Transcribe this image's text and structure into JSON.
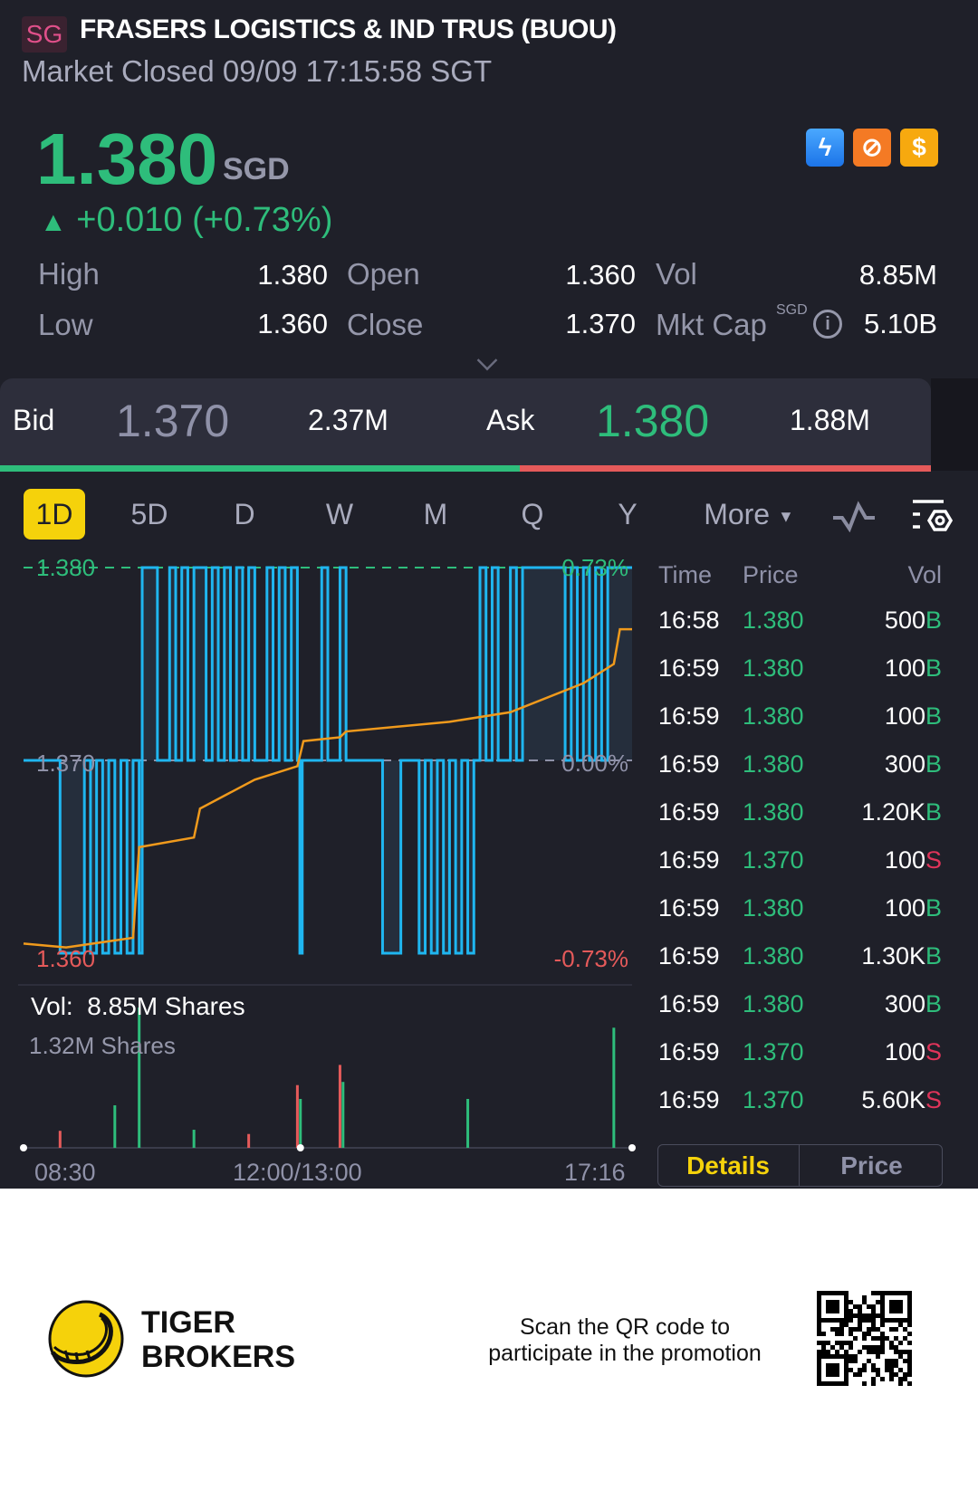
{
  "header": {
    "market_badge": "SG",
    "title": "FRASERS LOGISTICS & IND TRUS (BUOU)",
    "status": "Market Closed 09/09 17:15:58 SGT"
  },
  "quote": {
    "price": "1.380",
    "currency": "SGD",
    "change": "+0.010 (+0.73%)",
    "change_arrow": "▲",
    "stats": {
      "high_label": "High",
      "high": "1.380",
      "low_label": "Low",
      "low": "1.360",
      "open_label": "Open",
      "open": "1.360",
      "close_label": "Close",
      "close": "1.370",
      "vol_label": "Vol",
      "vol": "8.85M",
      "mktcap_label": "Mkt Cap",
      "mktcap_unit": "SGD",
      "mktcap": "5.10B"
    },
    "badges": [
      "lightning-level1-icon",
      "no-short-icon",
      "dollar-icon"
    ]
  },
  "bidask": {
    "bid_label": "Bid",
    "bid": "1.370",
    "bid_size": "2.37M",
    "ask_label": "Ask",
    "ask": "1.380",
    "ask_size": "1.88M",
    "bid_fraction": 0.558
  },
  "tabs": [
    "1D",
    "5D",
    "D",
    "W",
    "M",
    "Q",
    "Y",
    "More"
  ],
  "active_tab": "1D",
  "colors": {
    "up": "#2ebd7b",
    "down": "#e55a5a",
    "line": "#1fb6f0",
    "avg": "#f09a1c",
    "accent": "#f5d20b"
  },
  "chart_data": {
    "type": "line",
    "y_labels": {
      "top": "1.380",
      "mid": "1.370",
      "bottom": "1.360"
    },
    "pct_labels": {
      "top": "0.73%",
      "mid": "0.00%",
      "bottom": "-0.73%"
    },
    "ylim": [
      1.36,
      1.38
    ],
    "x_labels": [
      "08:30",
      "12:00/13:00",
      "17:16"
    ],
    "price_steps": [
      [
        0,
        1.37
      ],
      [
        6,
        1.36
      ],
      [
        10,
        1.37
      ],
      [
        11,
        1.36
      ],
      [
        12,
        1.37
      ],
      [
        13,
        1.36
      ],
      [
        14,
        1.37
      ],
      [
        15,
        1.36
      ],
      [
        16,
        1.37
      ],
      [
        17,
        1.36
      ],
      [
        18,
        1.37
      ],
      [
        19,
        1.36
      ],
      [
        19.5,
        1.38
      ],
      [
        22,
        1.37
      ],
      [
        24,
        1.38
      ],
      [
        25,
        1.37
      ],
      [
        26,
        1.38
      ],
      [
        27,
        1.37
      ],
      [
        28,
        1.38
      ],
      [
        30,
        1.37
      ],
      [
        31,
        1.38
      ],
      [
        32,
        1.37
      ],
      [
        33,
        1.38
      ],
      [
        34,
        1.37
      ],
      [
        35,
        1.38
      ],
      [
        36,
        1.37
      ],
      [
        37,
        1.38
      ],
      [
        38,
        1.37
      ],
      [
        40,
        1.38
      ],
      [
        41,
        1.37
      ],
      [
        42,
        1.38
      ],
      [
        43,
        1.37
      ],
      [
        44,
        1.38
      ],
      [
        45,
        1.37
      ],
      [
        45.4,
        1.36
      ],
      [
        45.8,
        1.37
      ],
      [
        49,
        1.38
      ],
      [
        50,
        1.37
      ],
      [
        52,
        1.38
      ],
      [
        53,
        1.37
      ],
      [
        59,
        1.36
      ],
      [
        62,
        1.37
      ],
      [
        65,
        1.36
      ],
      [
        66,
        1.37
      ],
      [
        67,
        1.36
      ],
      [
        68,
        1.37
      ],
      [
        69,
        1.36
      ],
      [
        70,
        1.37
      ],
      [
        71,
        1.36
      ],
      [
        72,
        1.37
      ],
      [
        73,
        1.36
      ],
      [
        74,
        1.37
      ],
      [
        75,
        1.38
      ],
      [
        76,
        1.37
      ],
      [
        77,
        1.38
      ],
      [
        78,
        1.37
      ],
      [
        80,
        1.38
      ],
      [
        81,
        1.37
      ],
      [
        82,
        1.38
      ],
      [
        89,
        1.37
      ],
      [
        90,
        1.38
      ],
      [
        91,
        1.37
      ],
      [
        92,
        1.38
      ],
      [
        93,
        1.37
      ],
      [
        94,
        1.38
      ],
      [
        95,
        1.37
      ],
      [
        96,
        1.38
      ],
      [
        100,
        1.38
      ]
    ],
    "avg_line": [
      [
        0,
        1.3605
      ],
      [
        7,
        1.3603
      ],
      [
        18,
        1.3608
      ],
      [
        19,
        1.3655
      ],
      [
        28,
        1.366
      ],
      [
        29,
        1.3675
      ],
      [
        38,
        1.369
      ],
      [
        45,
        1.3697
      ],
      [
        46,
        1.371
      ],
      [
        52,
        1.3712
      ],
      [
        53,
        1.3715
      ],
      [
        70,
        1.372
      ],
      [
        80,
        1.3725
      ],
      [
        92,
        1.374
      ],
      [
        97,
        1.375
      ],
      [
        98,
        1.3768
      ],
      [
        100,
        1.3768
      ]
    ],
    "volume": {
      "label": "Vol:",
      "total": "8.85M Shares",
      "max_label": "1.32M Shares",
      "max": 1.32,
      "bars": [
        [
          6,
          0.16,
          "S"
        ],
        [
          15,
          0.4,
          "B"
        ],
        [
          19,
          1.32,
          "B"
        ],
        [
          28,
          0.17,
          "B"
        ],
        [
          37,
          0.13,
          "S"
        ],
        [
          45,
          0.59,
          "S"
        ],
        [
          45.5,
          0.46,
          "B"
        ],
        [
          52,
          0.78,
          "S"
        ],
        [
          52.5,
          0.62,
          "B"
        ],
        [
          73,
          0.46,
          "B"
        ],
        [
          97,
          1.13,
          "B"
        ]
      ]
    }
  },
  "trades": {
    "headers": {
      "time": "Time",
      "price": "Price",
      "vol": "Vol"
    },
    "rows": [
      {
        "time": "16:58",
        "price": "1.380",
        "vol": "500",
        "side": "B"
      },
      {
        "time": "16:59",
        "price": "1.380",
        "vol": "100",
        "side": "B"
      },
      {
        "time": "16:59",
        "price": "1.380",
        "vol": "100",
        "side": "B"
      },
      {
        "time": "16:59",
        "price": "1.380",
        "vol": "300",
        "side": "B"
      },
      {
        "time": "16:59",
        "price": "1.380",
        "vol": "1.20K",
        "side": "B"
      },
      {
        "time": "16:59",
        "price": "1.370",
        "vol": "100",
        "side": "S"
      },
      {
        "time": "16:59",
        "price": "1.380",
        "vol": "100",
        "side": "B"
      },
      {
        "time": "16:59",
        "price": "1.380",
        "vol": "1.30K",
        "side": "B"
      },
      {
        "time": "16:59",
        "price": "1.380",
        "vol": "300",
        "side": "B"
      },
      {
        "time": "16:59",
        "price": "1.370",
        "vol": "100",
        "side": "S"
      },
      {
        "time": "16:59",
        "price": "1.370",
        "vol": "5.60K",
        "side": "S"
      }
    ],
    "details_label": "Details",
    "price_label": "Price"
  },
  "promo": {
    "brand_line1": "TIGER",
    "brand_line2": "BROKERS",
    "text_line1": "Scan the QR code to",
    "text_line2": "participate in the promotion"
  }
}
